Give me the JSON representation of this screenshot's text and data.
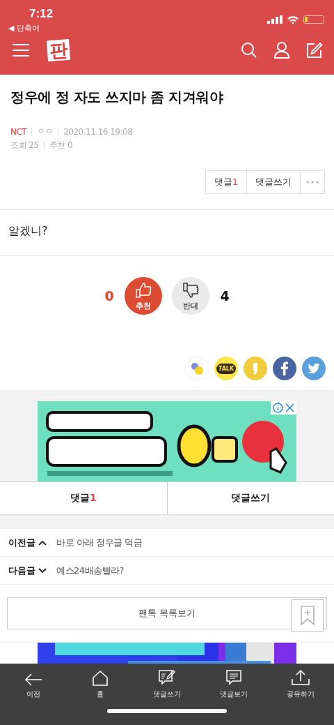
{
  "status_bar": {
    "time": "7:12",
    "back_app": "◀ 단축어"
  },
  "app_bar": {
    "logo": "판"
  },
  "post": {
    "title": "정우에 정 자도 쓰지마 좀 지겨워야",
    "category": "NCT",
    "author": "ㅇㅇ",
    "date": "2020.11.16 19:08",
    "views": "조회 25",
    "recommends": "추천 0",
    "actions": [
      {
        "label": "댓글",
        "count": "1"
      },
      {
        "label": "댓글쓰기"
      }
    ],
    "body": "알겠니?"
  },
  "votes": {
    "up_count": "0",
    "up_label": "추천",
    "down_label": "반대",
    "down_count": "4",
    "up_selected": true
  },
  "share": [
    {
      "kind": "dots"
    },
    {
      "kind": "talk",
      "label": "TALK"
    },
    {
      "kind": "story"
    },
    {
      "kind": "facebook"
    },
    {
      "kind": "twitter"
    }
  ],
  "comment_tabs": [
    {
      "label": "댓글",
      "count": "1"
    },
    {
      "label": "댓글쓰기"
    }
  ],
  "nav": [
    {
      "label": "이전글",
      "kind": "previous",
      "title": "바로 아래 정우글 먹금"
    },
    {
      "label": "다음글",
      "kind": "next",
      "title": "예스24배송빨라?"
    }
  ],
  "list_button": "팬톡 목록보기",
  "bottom_bar": [
    {
      "kind": "back",
      "label": "이전"
    },
    {
      "kind": "home",
      "label": "홈"
    },
    {
      "kind": "write",
      "label": "댓글쓰기"
    },
    {
      "kind": "view",
      "label": "댓글보기"
    },
    {
      "kind": "share",
      "label": "공유하기"
    }
  ]
}
